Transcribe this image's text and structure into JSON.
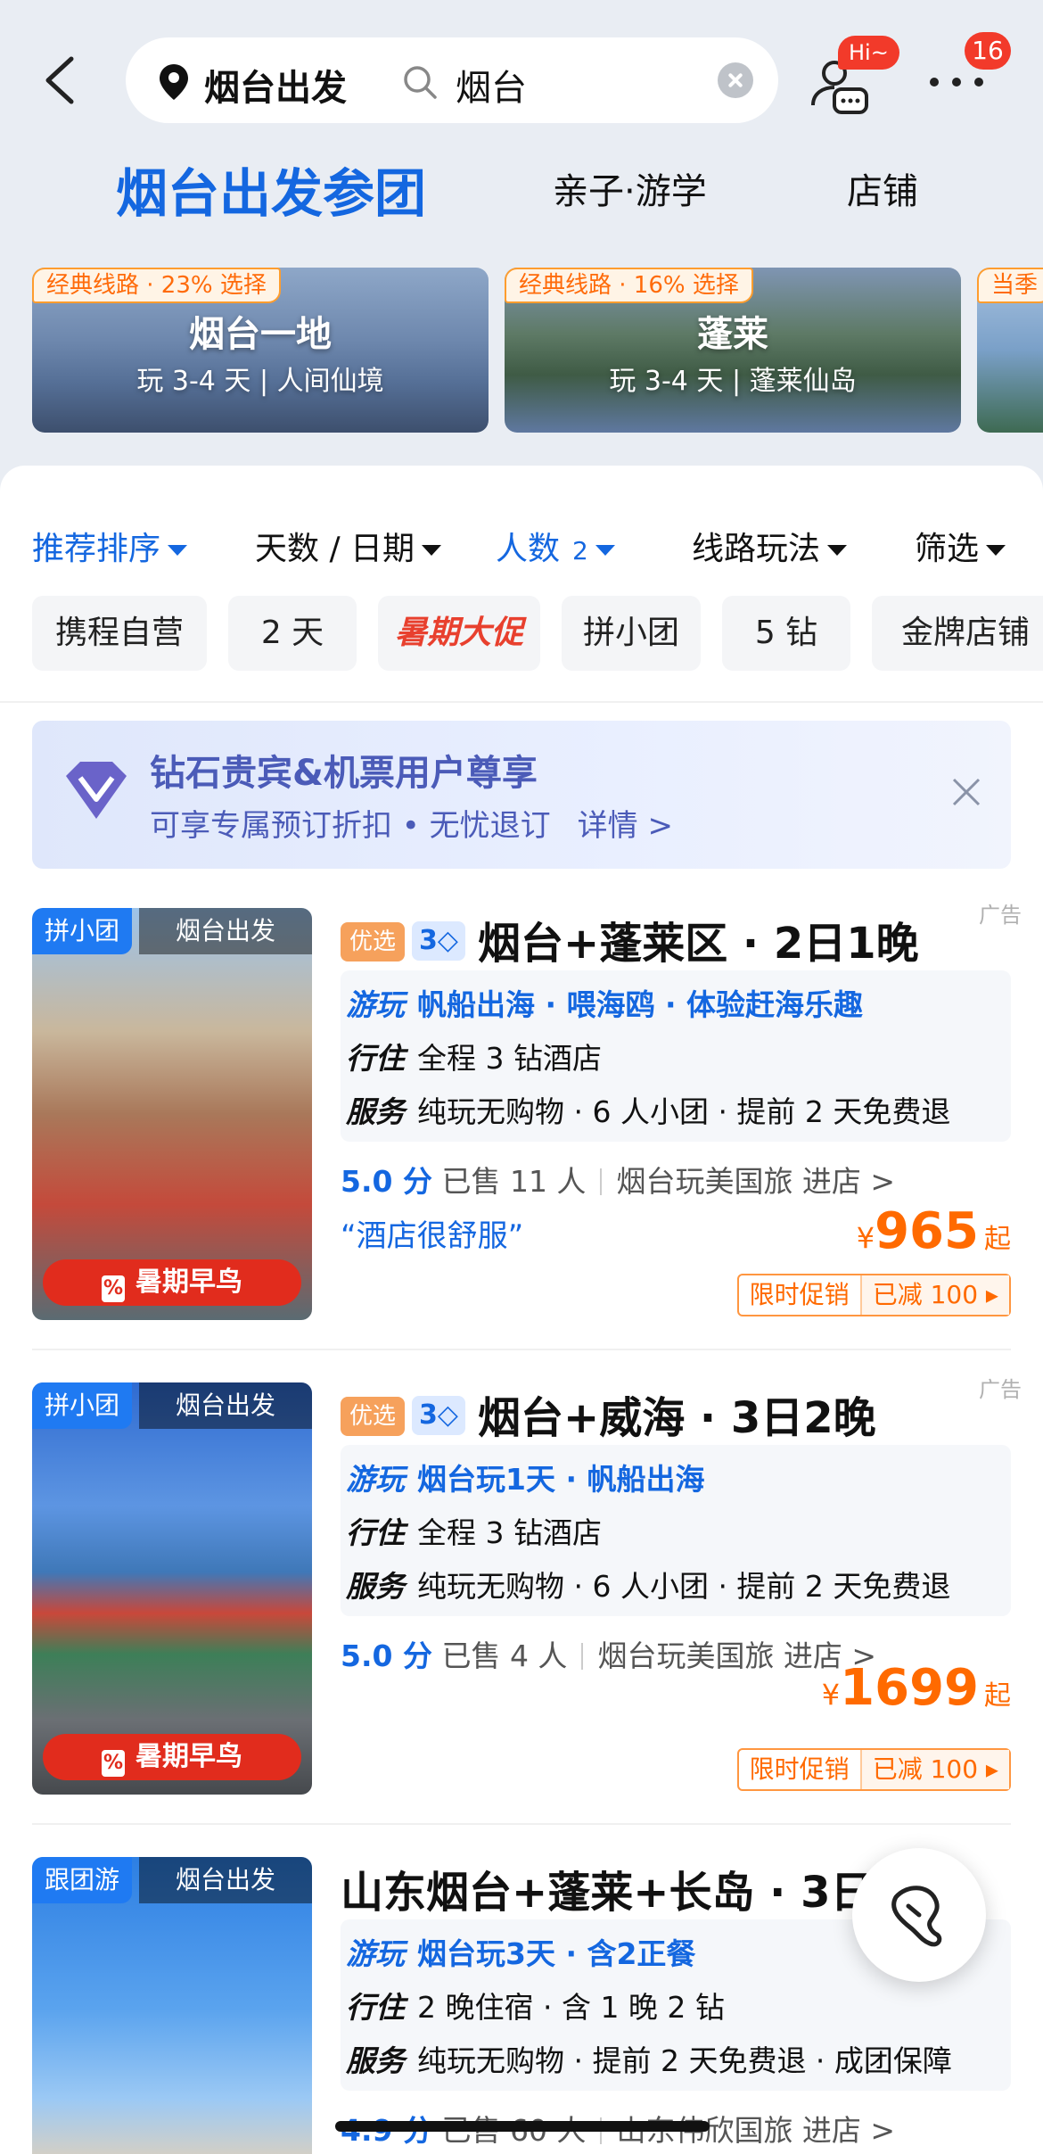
{
  "header": {
    "departure": "烟台出发",
    "query": "烟台",
    "hi_badge": "Hi~",
    "more_badge": "16"
  },
  "tabs": [
    {
      "label": "烟台出发参团",
      "active": true
    },
    {
      "label": "亲子·游学",
      "active": false
    },
    {
      "label": "店铺",
      "active": false
    }
  ],
  "destinations": [
    {
      "tag": "经典线路 · 23% 选择",
      "name": "烟台一地",
      "sub": "玩 3-4 天 | 人间仙境"
    },
    {
      "tag": "经典线路 · 16% 选择",
      "name": "蓬莱",
      "sub": "玩 3-4 天 | 蓬莱仙岛"
    },
    {
      "tag": "当季"
    }
  ],
  "filters": [
    {
      "label": "推荐排序",
      "active": true
    },
    {
      "label": "天数 / 日期",
      "active": false
    },
    {
      "label": "人数",
      "count": "2",
      "active": true
    },
    {
      "label": "线路玩法",
      "active": false
    },
    {
      "label": "筛选",
      "active": false
    }
  ],
  "chips": [
    "携程自营",
    "2 天",
    "暑期大促",
    "拼小团",
    "5 钻",
    "金牌店铺"
  ],
  "banner": {
    "title": "钻石贵宾&机票用户尊享",
    "subtitle": "可享专属预订折扣 • 无忧退订",
    "detail": "详情 >"
  },
  "products": [
    {
      "tag_type": "拼小团",
      "tag_from": "烟台出发",
      "early": "暑期早鸟",
      "badge": "优选",
      "diamond": "3",
      "title": "烟台+蓬莱区 · 2日1晚",
      "ad": "广告",
      "play_k": "游玩",
      "play_v": "帆船出海 · 喂海鸥 · 体验赶海乐趣",
      "stay_k": "行住",
      "stay_v": "全程 3 钻酒店",
      "serv_k": "服务",
      "serv_v": "纯玩无购物 · 6 人小团 · 提前 2 天免费退",
      "score": "5.0 分",
      "sold": "已售 11 人",
      "shop": "烟台玩美国旅 进店 >",
      "quote": "“酒店很舒服”",
      "price_sym": "¥",
      "price": "965",
      "price_unit": "起",
      "promo_l": "限时促销",
      "promo_r": "已减 100 ▸"
    },
    {
      "tag_type": "拼小团",
      "tag_from": "烟台出发",
      "early": "暑期早鸟",
      "badge": "优选",
      "diamond": "3",
      "title": "烟台+威海 · 3日2晚",
      "ad": "广告",
      "play_k": "游玩",
      "play_v": "烟台玩1天 · 帆船出海",
      "stay_k": "行住",
      "stay_v": "全程 3 钻酒店",
      "serv_k": "服务",
      "serv_v": "纯玩无购物 · 6 人小团 · 提前 2 天免费退",
      "score": "5.0 分",
      "sold": "已售 4 人",
      "shop": "烟台玩美国旅 进店 >",
      "price_sym": "¥",
      "price": "1699",
      "price_unit": "起",
      "promo_l": "限时促销",
      "promo_r": "已减 100 ▸"
    },
    {
      "tag_type": "跟团游",
      "tag_from": "烟台出发",
      "title": "山东烟台+蓬莱+长岛 · 3日2",
      "play_k": "游玩",
      "play_v": "烟台玩3天 · 含2正餐",
      "stay_k": "行住",
      "stay_v": "2 晚住宿 · 含 1 晚 2 钻",
      "serv_k": "服务",
      "serv_v": "纯玩无购物 · 提前 2 天免费退 · 成团保障",
      "score": "4.9 分",
      "sold": "已售 60 人",
      "shop": "山东伟欣国旅 进店 >"
    }
  ]
}
